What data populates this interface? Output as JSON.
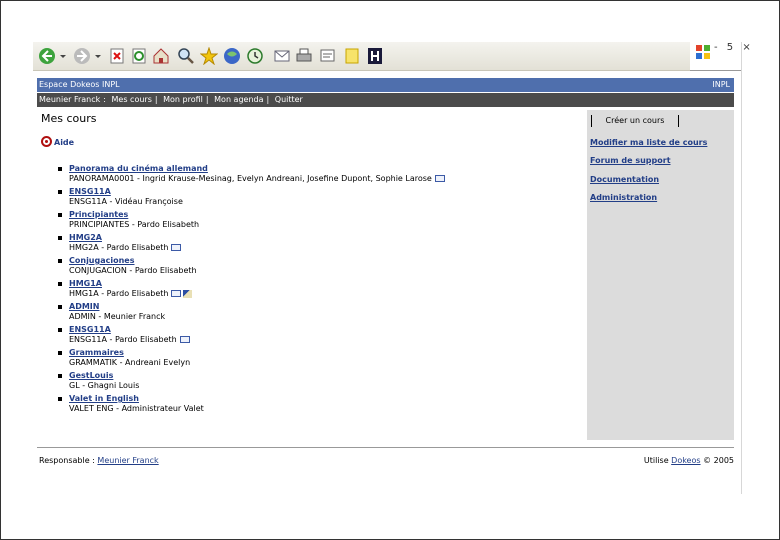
{
  "header": {
    "site_title": "Espace Dokeos INPL",
    "institution": "INPL"
  },
  "nav": {
    "items": [
      {
        "label": "Meunier Franck"
      },
      {
        "label": "Mes cours"
      },
      {
        "label": "Mon profil"
      },
      {
        "label": "Mon agenda"
      },
      {
        "label": "Quitter"
      }
    ]
  },
  "main": {
    "title": "Mes cours",
    "help_label": "Aide",
    "courses": [
      {
        "title": "Panorama du cinéma allemand",
        "desc": "PANORAMA0001 - Ingrid Krause-Mesinag, Evelyn Andreani, Josefine Dupont, Sophie Larose",
        "icons": [
          "mail"
        ]
      },
      {
        "title": "ENSG11A",
        "desc": "ENSG11A - Vidéau Françoise",
        "icons": []
      },
      {
        "title": "Principiantes",
        "desc": "PRINCIPIANTES - Pardo Elisabeth",
        "icons": []
      },
      {
        "title": "HMG2A",
        "desc": "HMG2A - Pardo Elisabeth",
        "icons": [
          "mail"
        ]
      },
      {
        "title": "Conjugaciones",
        "desc": "CONJUGACION - Pardo Elisabeth",
        "icons": []
      },
      {
        "title": "HMG1A",
        "desc": "HMG1A - Pardo Elisabeth",
        "icons": [
          "mail",
          "edit"
        ]
      },
      {
        "title": "ADMIN",
        "desc": "ADMIN - Meunier Franck",
        "icons": []
      },
      {
        "title": "ENSG11A",
        "desc": "ENSG11A - Pardo Elisabeth",
        "icons": [
          "mail"
        ]
      },
      {
        "title": "Grammaires",
        "desc": "GRAMMATIK - Andreani Evelyn",
        "icons": []
      },
      {
        "title": "GestLouis",
        "desc": "GL - Ghagni Louis",
        "icons": []
      },
      {
        "title": "Valet in English",
        "desc": "VALET ENG - Administrateur Valet",
        "icons": []
      }
    ]
  },
  "sidebar": {
    "create_label": "Créer un cours",
    "links": [
      {
        "label": "Modifier ma liste de cours"
      },
      {
        "label": "Forum de support"
      },
      {
        "label": "Documentation"
      },
      {
        "label": "Administration"
      }
    ]
  },
  "footer": {
    "responsible_label": "Responsable :",
    "responsible_name": "Meunier Franck",
    "platform_prefix": "Utilise",
    "platform_link": "Dokeos",
    "copyright": "© 2005"
  },
  "window": {
    "controls": "- 5 ×"
  }
}
